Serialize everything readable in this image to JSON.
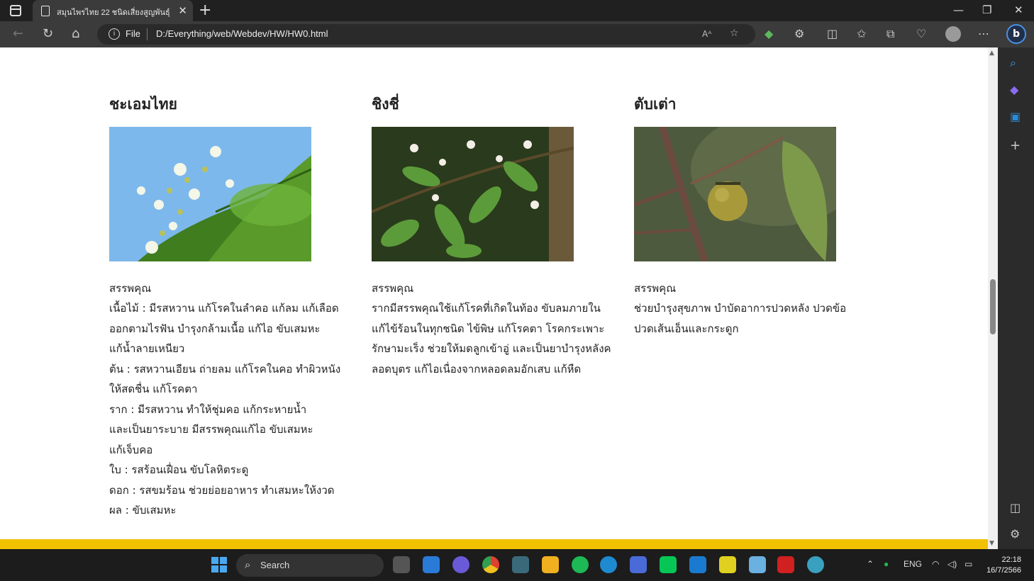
{
  "browser": {
    "tab_title": "สมุนไพรไทย 22 ชนิดเสี่ยงสูญพันธุ์",
    "address_scheme": "File",
    "address_url": "D:/Everything/web/Webdev/HW/HW0.html"
  },
  "plants": [
    {
      "name": "ชะเอมไทย",
      "label": "สรรพคุณ",
      "lines": [
        "เนื้อไม้ : มีรสหวาน แก้โรคในลำคอ แก้ลม แก้เลือด",
        "ออกตามไรฟัน บำรุงกล้ามเนื้อ แก้ไอ ขับเสมหะ",
        "แก้น้ำลายเหนียว",
        "ต้น : รสหวานเอียน ถ่ายลม แก้โรคในคอ ทำผิวหนัง",
        "ให้สดชื่น แก้โรคตา",
        "ราก : มีรสหวาน ทำให้ชุ่มคอ แก้กระหายน้ำ",
        "และเป็นยาระบาย มีสรรพคุณแก้ไอ ขับเสมหะ",
        "แก้เจ็บคอ",
        "ใบ : รสร้อนเฝื่อน ขับโลหิตระดู",
        "ดอก : รสขมร้อน ช่วยย่อยอาหาร ทำเสมหะให้งวด",
        "ผล : ขับเสมหะ"
      ]
    },
    {
      "name": "ชิงชี่",
      "label": "สรรพคุณ",
      "lines": [
        "รากมีสรรพคุณใช้แก้โรคที่เกิดในท้อง ขับลมภายใน",
        "แก้ไข้ร้อนในทุกชนิด ไข้พิษ แก้โรคตา โรคกระเพาะ",
        "รักษามะเร็ง ช่วยให้มดลูกเข้าอู่ และเป็นยาบำรุงหลังค",
        "ลอดบุตร แก้ไอเนื่องจากหลอดลมอักเสบ แก้หืด"
      ]
    },
    {
      "name": "ตับเต่า",
      "label": "สรรพคุณ",
      "lines": [
        "ช่วยบำรุงสุขภาพ บำบัดอาการปวดหลัง ปวดข้อ",
        "ปวดเส้นเอ็นและกระดูก"
      ]
    }
  ],
  "taskbar": {
    "search_label": "Search",
    "language": "ENG",
    "time": "22:18",
    "date": "16/7/2566"
  }
}
